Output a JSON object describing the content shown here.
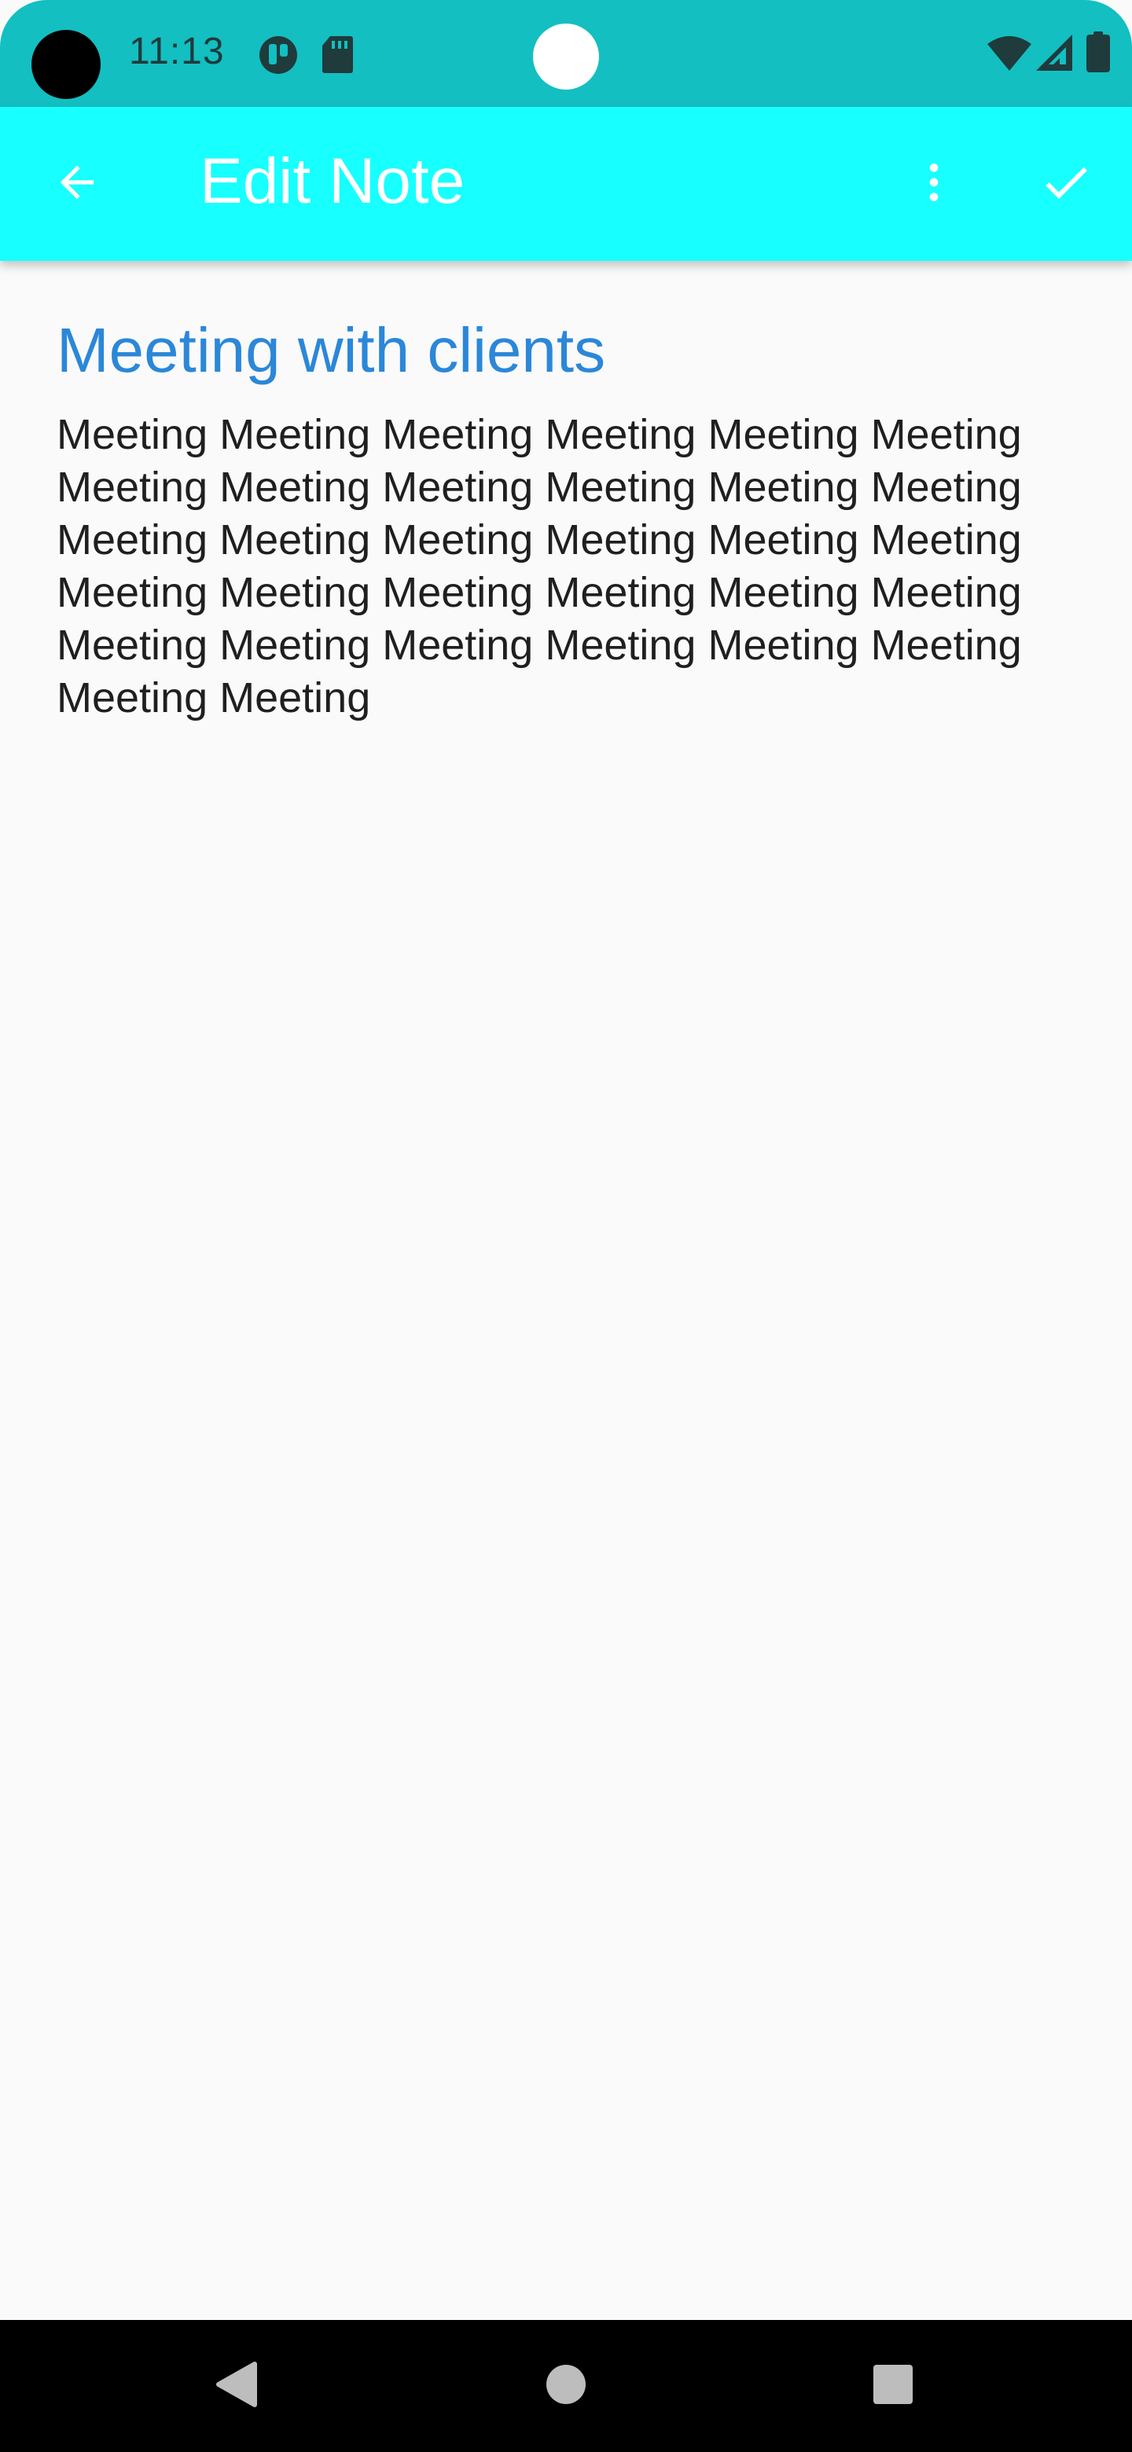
{
  "status_bar": {
    "time": "11:13",
    "icons": [
      "camera-hole",
      "notification-app-icon",
      "sd-card-icon",
      "wifi-icon",
      "signal-icon",
      "battery-icon"
    ]
  },
  "app_bar": {
    "title": "Edit Note",
    "back_icon": "arrow-back-icon",
    "more_icon": "more-vert-icon",
    "save_icon": "check-icon"
  },
  "note": {
    "title": "Meeting with clients",
    "body": "Meeting Meeting Meeting Meeting Meeting Meeting Meeting Meeting Meeting Meeting Meeting Meeting Meeting Meeting Meeting Meeting Meeting Meeting Meeting Meeting Meeting Meeting Meeting Meeting Meeting Meeting Meeting Meeting Meeting Meeting Meeting Meeting"
  },
  "nav_bar": {
    "back_icon": "nav-back-icon",
    "home_icon": "nav-home-icon",
    "recents_icon": "nav-recents-icon"
  },
  "colors": {
    "status_bar": "#13bfc1",
    "app_bar": "#17ffff",
    "title_accent": "#2b87d8",
    "background": "#fafafa"
  }
}
